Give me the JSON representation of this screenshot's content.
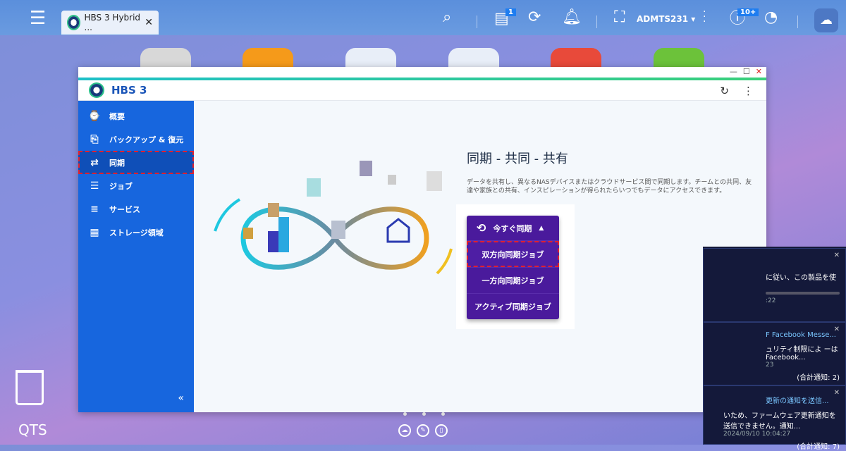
{
  "taskbar": {
    "tab_title": "HBS 3 Hybrid ...",
    "tab_close": "✕",
    "news_badge": "1",
    "user": "ADMTS231",
    "user_caret": "▾",
    "events_badge": "10+"
  },
  "window": {
    "title": "HBS 3",
    "controls": [
      "—",
      "☐",
      "✕"
    ],
    "refresh": "↻",
    "more": "⋮"
  },
  "sidebar": {
    "items": [
      {
        "label": "概要",
        "icon": "⌚"
      },
      {
        "label": "バックアップ & 復元",
        "icon": "⎘"
      },
      {
        "label": "同期",
        "icon": "⇄"
      },
      {
        "label": "ジョブ",
        "icon": "☰"
      },
      {
        "label": "サービス",
        "icon": "≡"
      },
      {
        "label": "ストレージ領域",
        "icon": "▦"
      }
    ],
    "collapse": "«"
  },
  "main": {
    "title": "同期 - 共同 - 共有",
    "description": "データを共有し、異なるNASデバイスまたはクラウドサービス間で同期します。チームとの共同、友達や家族との共有、インスピレーションが得られたらいつでもデータにアクセスできます。",
    "sync_now": "今すぐ同期",
    "sync_caret": "▲",
    "menu": [
      "双方向同期ジョブ",
      "一方向同期ジョブ",
      "アクティブ同期ジョブ"
    ]
  },
  "notifications": [
    {
      "text": "に従い、この製品を使",
      "date": ":22"
    },
    {
      "title": "F Facebook Messe...",
      "text": "ュリティ制限によ ーは Facebook...",
      "date": "23",
      "count": "(合計通知: 2)"
    },
    {
      "title": "更新の通知を送信...",
      "text": "いため、ファームウェア更新通知を送信できません。通知...",
      "date": "2024/09/10 10:04:27",
      "count": "(合計通知: 7)"
    }
  ],
  "desktop": {
    "label": "QTS"
  }
}
